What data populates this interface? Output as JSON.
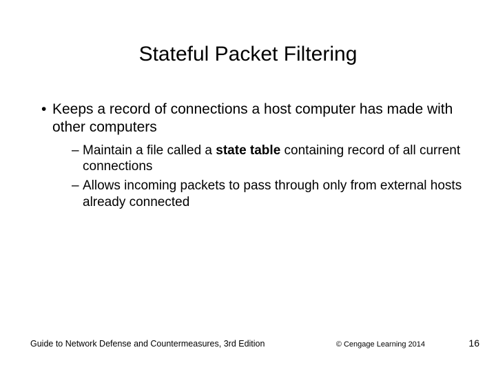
{
  "title": "Stateful Packet Filtering",
  "bullets": {
    "l1_0": "Keeps a record of connections a host computer has made with other computers",
    "l2_0a": "Maintain a file called a ",
    "l2_0b": "state table",
    "l2_0c": " containing record of all current connections",
    "l2_1": "Allows incoming packets to pass through only from external hosts already connected"
  },
  "footer": {
    "left": "Guide to Network Defense and Countermeasures, 3rd Edition",
    "mid": "© Cengage Learning  2014",
    "right": "16"
  }
}
